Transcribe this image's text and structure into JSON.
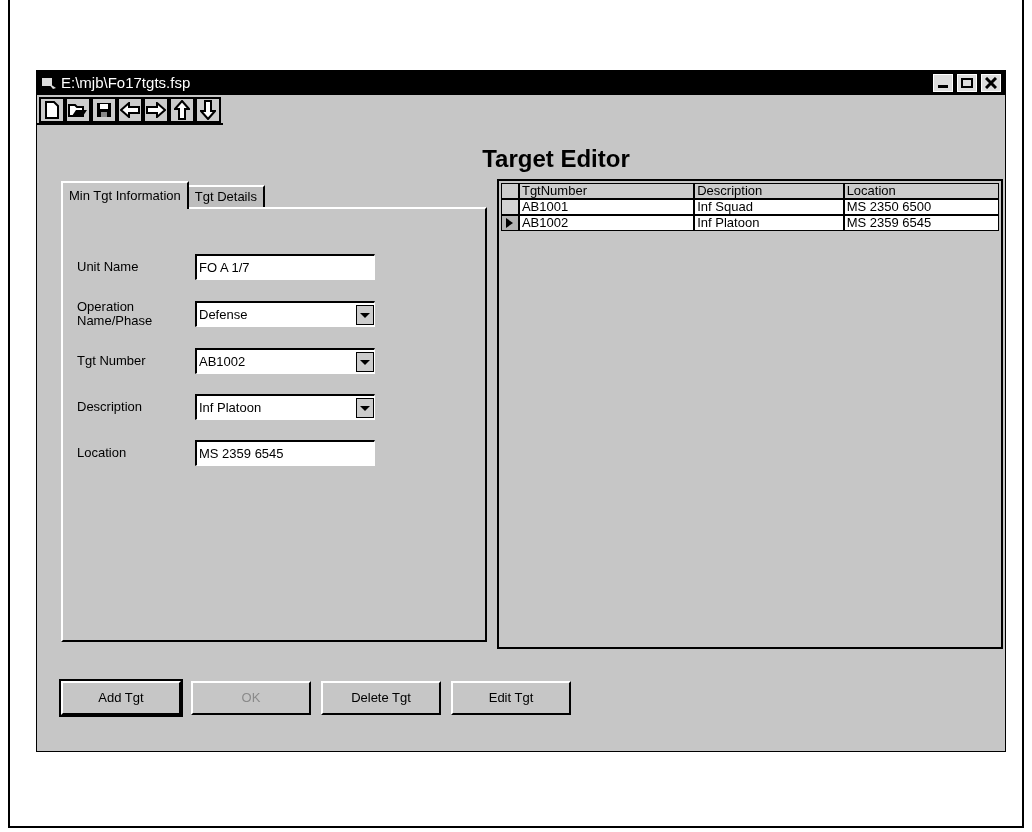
{
  "window": {
    "title": "E:\\mjb\\Fo17tgts.fsp"
  },
  "heading": "Target Editor",
  "tabs": [
    {
      "label": "Min Tgt Information",
      "selected": true
    },
    {
      "label": "Tgt Details",
      "selected": false
    }
  ],
  "fields": [
    {
      "label": "Unit Name",
      "kind": "text",
      "value": "FO A 1/7"
    },
    {
      "label": "Operation Name/Phase",
      "kind": "combo",
      "value": "Defense"
    },
    {
      "label": "Tgt Number",
      "kind": "combo",
      "value": "AB1002"
    },
    {
      "label": "Description",
      "kind": "combo",
      "value": "Inf Platoon"
    },
    {
      "label": "Location",
      "kind": "text",
      "value": "MS 2359 6545"
    }
  ],
  "table": {
    "columns": [
      "TgtNumber",
      "Description",
      "Location"
    ],
    "rows": [
      {
        "cells": [
          "AB1001",
          "Inf Squad",
          "MS 2350 6500"
        ],
        "selected": false
      },
      {
        "cells": [
          "AB1002",
          "Inf Platoon",
          "MS 2359 6545"
        ],
        "selected": true
      }
    ]
  },
  "buttons": [
    {
      "label": "Add Tgt",
      "disabled": false,
      "default": true
    },
    {
      "label": "OK",
      "disabled": true,
      "default": false
    },
    {
      "label": "Delete Tgt",
      "disabled": false,
      "default": false
    },
    {
      "label": "Edit Tgt",
      "disabled": false,
      "default": false
    }
  ]
}
